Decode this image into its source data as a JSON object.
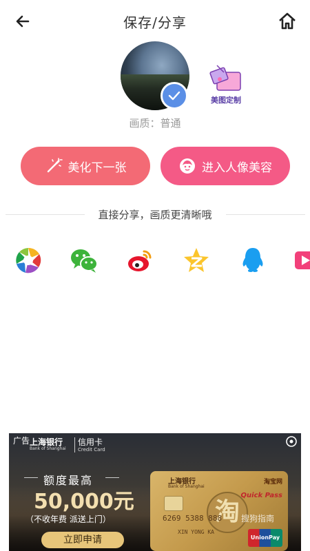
{
  "header": {
    "title": "保存/分享",
    "back_icon": "arrow-left-icon",
    "home_icon": "home-icon"
  },
  "preview": {
    "quality_label": "画质：普通",
    "badge_icon": "checkmark-icon",
    "badge_color": "#5b8fe6"
  },
  "custom": {
    "label": "美图定制",
    "icon": "gift-ticket-icon"
  },
  "actions": {
    "beautify_next": "美化下一张",
    "portrait_beauty": "进入人像美容",
    "left_color": "#f36a75",
    "right_color": "#f45a86"
  },
  "share": {
    "divider_text": "直接分享，画质更清晰哦",
    "targets": [
      {
        "name": "moments",
        "icon": "camera-aperture-icon"
      },
      {
        "name": "wechat",
        "icon": "wechat-icon"
      },
      {
        "name": "weibo",
        "icon": "weibo-icon"
      },
      {
        "name": "qzone",
        "icon": "qzone-star-icon"
      },
      {
        "name": "qq",
        "icon": "qq-penguin-icon"
      },
      {
        "name": "video",
        "icon": "video-play-icon"
      }
    ]
  },
  "ad": {
    "tag": "广告",
    "bank_name": "上海银行",
    "bank_name_en": "Bank of Shanghai",
    "card_title": "信用卡",
    "card_title_en": "Credit Card",
    "quota_label": "额度最高",
    "amount": "50,000元",
    "description": "（不收年费 派送上门）",
    "apply_label": "立即申请",
    "card": {
      "bank": "上海银行",
      "bank_en": "Bank of Shanghai",
      "partner": "淘宝网",
      "quick_pass": "Quick Pass",
      "seal": "淘",
      "number": "6269 5388 888",
      "holder": "XIN YONG KA",
      "network": "UnionPay 银联"
    }
  },
  "watermark": "搜狗指南"
}
